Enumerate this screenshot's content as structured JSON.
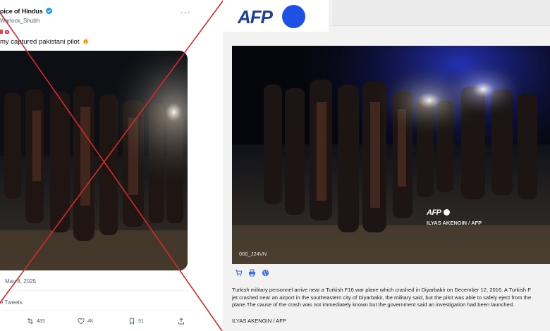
{
  "tweet": {
    "author_name": "oice of Hindus",
    "handle": "Warlock_Shubh",
    "more_label": "···",
    "text": "my captured pakistani pilot",
    "date": "May 8, 2025",
    "quote_tweets_label": "e Tweets",
    "actions": {
      "retweets": "483",
      "likes": "4K",
      "bookmarks": "91"
    },
    "icons": [
      "verified-badge-icon",
      "siren-icon",
      "fire-icon",
      "retweet-icon",
      "heart-icon",
      "bookmark-icon",
      "share-icon",
      "more-icon"
    ]
  },
  "overlay": {
    "cross_color": "#d22b2b"
  },
  "afp": {
    "logo_text": "AFP",
    "photo_watermark_logo": "AFP",
    "photo_watermark_credit": "ILYAS AKENGIN / AFP",
    "photo_id": "000_J24VN",
    "tool_icons": [
      "cart-icon",
      "print-icon",
      "globe-icon"
    ],
    "caption_lines": [
      "Turkish military personnel arrive near a Turkish F16 war plane which crashed in Diyarbakir on December 12, 2016. A Turkish F",
      "jet crashed near an airport in the southeastern city of Diyarbakir, the military said, but the pilot was able to safely eject from the",
      "plane.The cause of the crash was not immediately known but the government said an investigation had been launched."
    ],
    "credit": "ILYAS AKENGIN / AFP",
    "colors": {
      "brand_blue": "#1f50e6",
      "logo_navy": "#1f3f95"
    }
  }
}
